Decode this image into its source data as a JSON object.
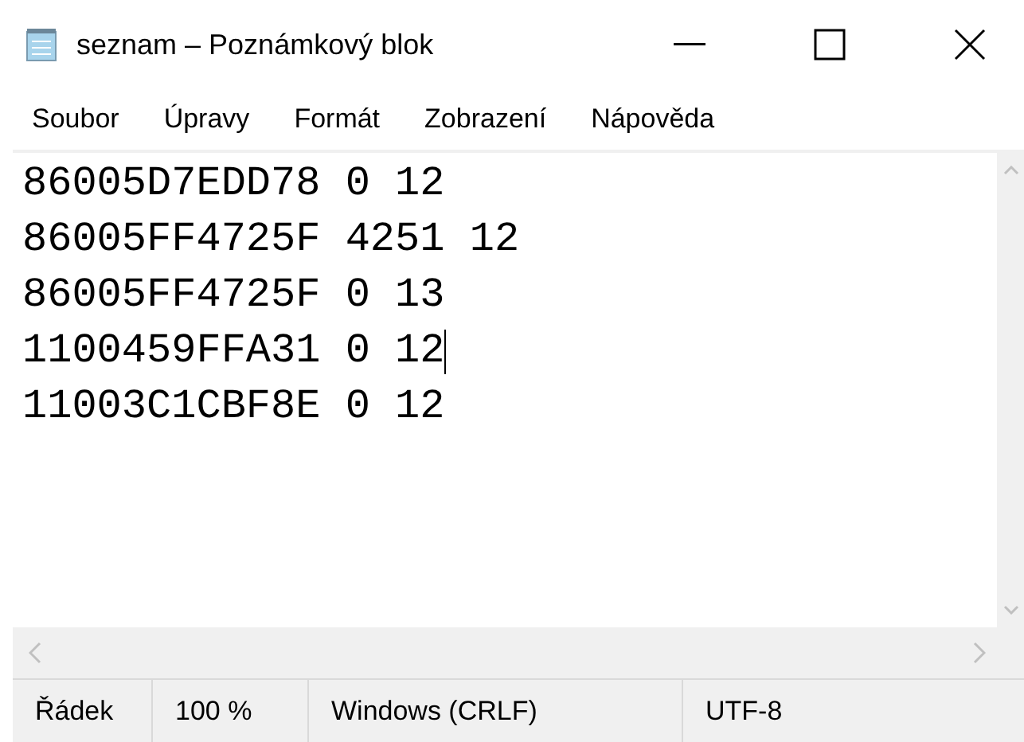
{
  "window": {
    "title": "seznam – Poznámkový blok"
  },
  "menu": [
    "Soubor",
    "Úpravy",
    "Formát",
    "Zobrazení",
    "Nápověda"
  ],
  "lines": [
    {
      "text": "86005D7EDD78 0 12",
      "cursor": false
    },
    {
      "text": "86005FF4725F 4251 12",
      "cursor": false
    },
    {
      "text": "86005FF4725F 0 13",
      "cursor": false
    },
    {
      "text": "1100459FFA31 0 12",
      "cursor": true
    },
    {
      "text": "11003C1CBF8E 0 12",
      "cursor": false
    }
  ],
  "status_bar": [
    "Řádek",
    "100 %",
    "Windows (CRLF)",
    "UTF-8"
  ]
}
